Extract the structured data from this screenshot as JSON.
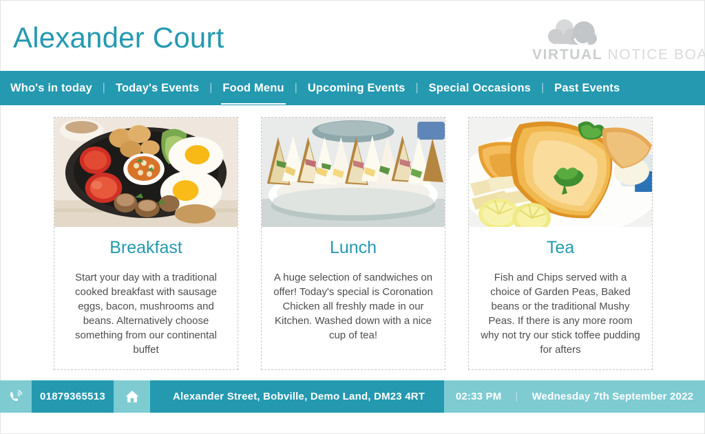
{
  "header": {
    "site_title": "Alexander Court",
    "logo": {
      "icon": "cloud-icon",
      "word_strong": "VIRTUAL",
      "word_light": "NOTICE BOARD"
    }
  },
  "nav": {
    "items": [
      {
        "label": "Who's in today",
        "active": false
      },
      {
        "label": "Today's Events",
        "active": false
      },
      {
        "label": "Food Menu",
        "active": true
      },
      {
        "label": "Upcoming Events",
        "active": false
      },
      {
        "label": "Special Occasions",
        "active": false
      },
      {
        "label": "Past Events",
        "active": false
      }
    ],
    "separator": "|"
  },
  "cards": [
    {
      "title": "Breakfast",
      "description": "Start your day with a traditional cooked breakfast with sausage eggs, bacon, mushrooms and beans. Alternatively choose something from our continental buffet",
      "photo": "cooked-breakfast-skillet-photo"
    },
    {
      "title": "Lunch",
      "description": "A huge selection of sandwiches on offer! Today's special is Coronation Chicken all freshly made in our Kitchen. Washed down with a nice cup of tea!",
      "photo": "sandwich-platter-photo"
    },
    {
      "title": "Tea",
      "description": "Fish and Chips served with a choice of Garden Peas, Baked beans or the traditional Mushy Peas. If there is any more room why not try our stick toffee pudding for afters",
      "photo": "fish-and-chips-photo"
    }
  ],
  "footer": {
    "phone_icon": "phone-ringing-icon",
    "phone": "01879365513",
    "home_icon": "home-icon",
    "address": "Alexander Street, Bobville, Demo Land, DM23 4RT",
    "time": "02:33 PM",
    "separator": "|",
    "date": "Wednesday 7th September 2022"
  },
  "colors": {
    "teal": "#2499b0",
    "teal_light": "#7ecbd2",
    "text": "#4d4d4d",
    "logo_grey": "#cbcdcf"
  }
}
